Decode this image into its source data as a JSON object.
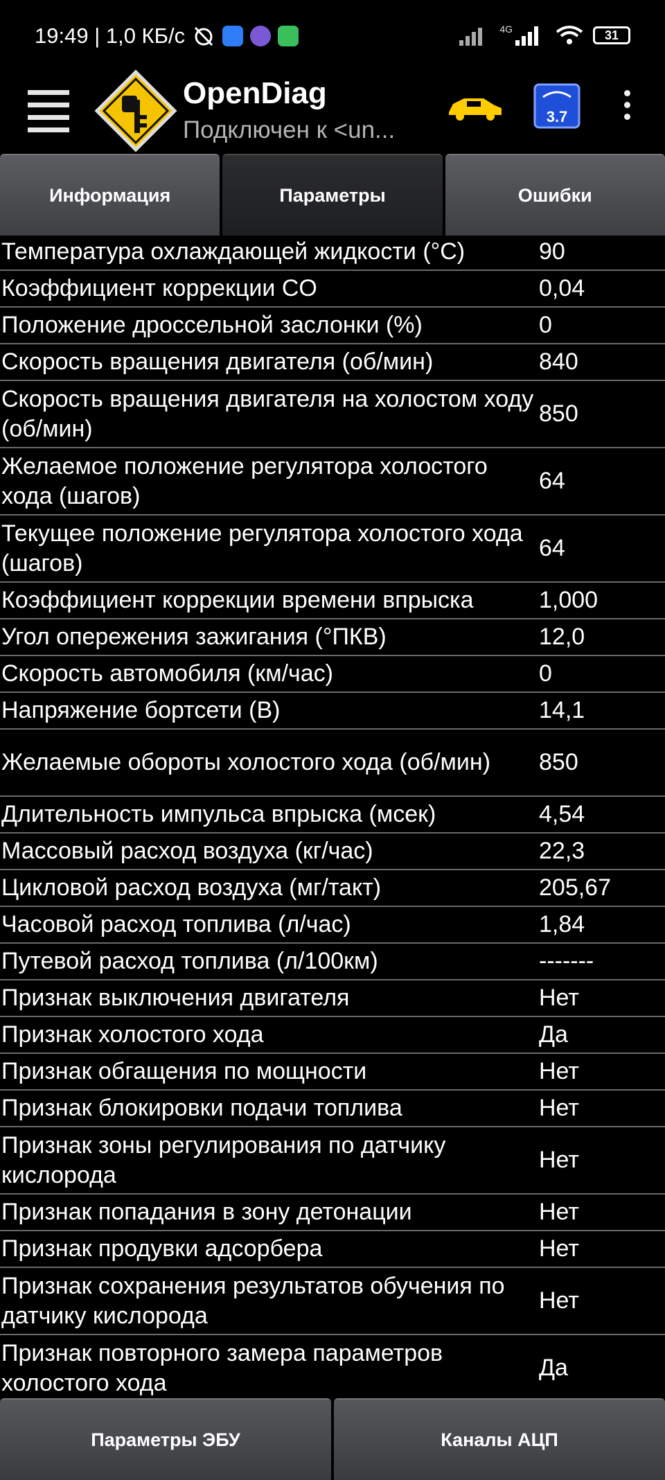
{
  "status_bar": {
    "time_info": "19:49 | 1,0 КБ/с",
    "battery": "31",
    "network": "4G"
  },
  "app_bar": {
    "title": "OpenDiag",
    "subtitle": "Подключен к <un...",
    "icons": [
      "menu-icon",
      "app-logo-icon",
      "car-icon",
      "obd-adapter-icon",
      "more-vert-icon"
    ]
  },
  "tabs": [
    {
      "label": "Информация"
    },
    {
      "label": "Параметры"
    },
    {
      "label": "Ошибки"
    }
  ],
  "params": [
    {
      "name": "Температура охлаждающей жидкости (°C)",
      "value": "90"
    },
    {
      "name": "Коэффициент коррекции CO",
      "value": "0,04"
    },
    {
      "name": "Положение дроссельной заслонки (%)",
      "value": "0"
    },
    {
      "name": "Скорость вращения двигателя (об/мин)",
      "value": "840"
    },
    {
      "name": "Скорость вращения двигателя на холостом ходу (об/мин)",
      "value": "850"
    },
    {
      "name": "Желаемое положение регулятора холостого хода (шагов)",
      "value": "64"
    },
    {
      "name": "Текущее положение регулятора холостого хода (шагов)",
      "value": "64"
    },
    {
      "name": "Коэффициент коррекции времени впрыска",
      "value": "1,000"
    },
    {
      "name": "Угол опережения зажигания (°ПКВ)",
      "value": "12,0"
    },
    {
      "name": "Скорость автомобиля (км/час)",
      "value": "0"
    },
    {
      "name": "Напряжение бортсети (В)",
      "value": "14,1"
    },
    {
      "name": "Желаемые обороты холостого хода (об/мин)",
      "value": "850"
    },
    {
      "name": "Длительность импульса впрыска (мсек)",
      "value": "4,54"
    },
    {
      "name": "Массовый расход воздуха (кг/час)",
      "value": "22,3"
    },
    {
      "name": "Цикловой расход воздуха (мг/такт)",
      "value": "205,67"
    },
    {
      "name": "Часовой расход топлива (л/час)",
      "value": "1,84"
    },
    {
      "name": "Путевой расход топлива (л/100км)",
      "value": "-------"
    },
    {
      "name": "Признак выключения двигателя",
      "value": "Нет"
    },
    {
      "name": "Признак холостого хода",
      "value": "Да"
    },
    {
      "name": "Признак обгащения по мощности",
      "value": "Нет"
    },
    {
      "name": "Признак блокировки подачи топлива",
      "value": "Нет"
    },
    {
      "name": "Признак зоны регулирования по датчику кислорода",
      "value": "Нет"
    },
    {
      "name": "Признак попадания в зону детонации",
      "value": "Нет"
    },
    {
      "name": "Признак продувки адсорбера",
      "value": "Нет"
    },
    {
      "name": "Признак сохранения результатов обучения по датчику кислорода",
      "value": "Нет"
    },
    {
      "name": "Признак повторного замера параметров холостого хода",
      "value": "Да"
    }
  ],
  "bottom_buttons": [
    {
      "label": "Параметры ЭБУ"
    },
    {
      "label": "Каналы АЦП"
    }
  ],
  "colors": {
    "background": "#000000",
    "logo_yellow": "#f5c400",
    "car_yellow": "#ffcc00",
    "obd_blue": "#1f4fd8",
    "divider": "#6a6a6a"
  }
}
